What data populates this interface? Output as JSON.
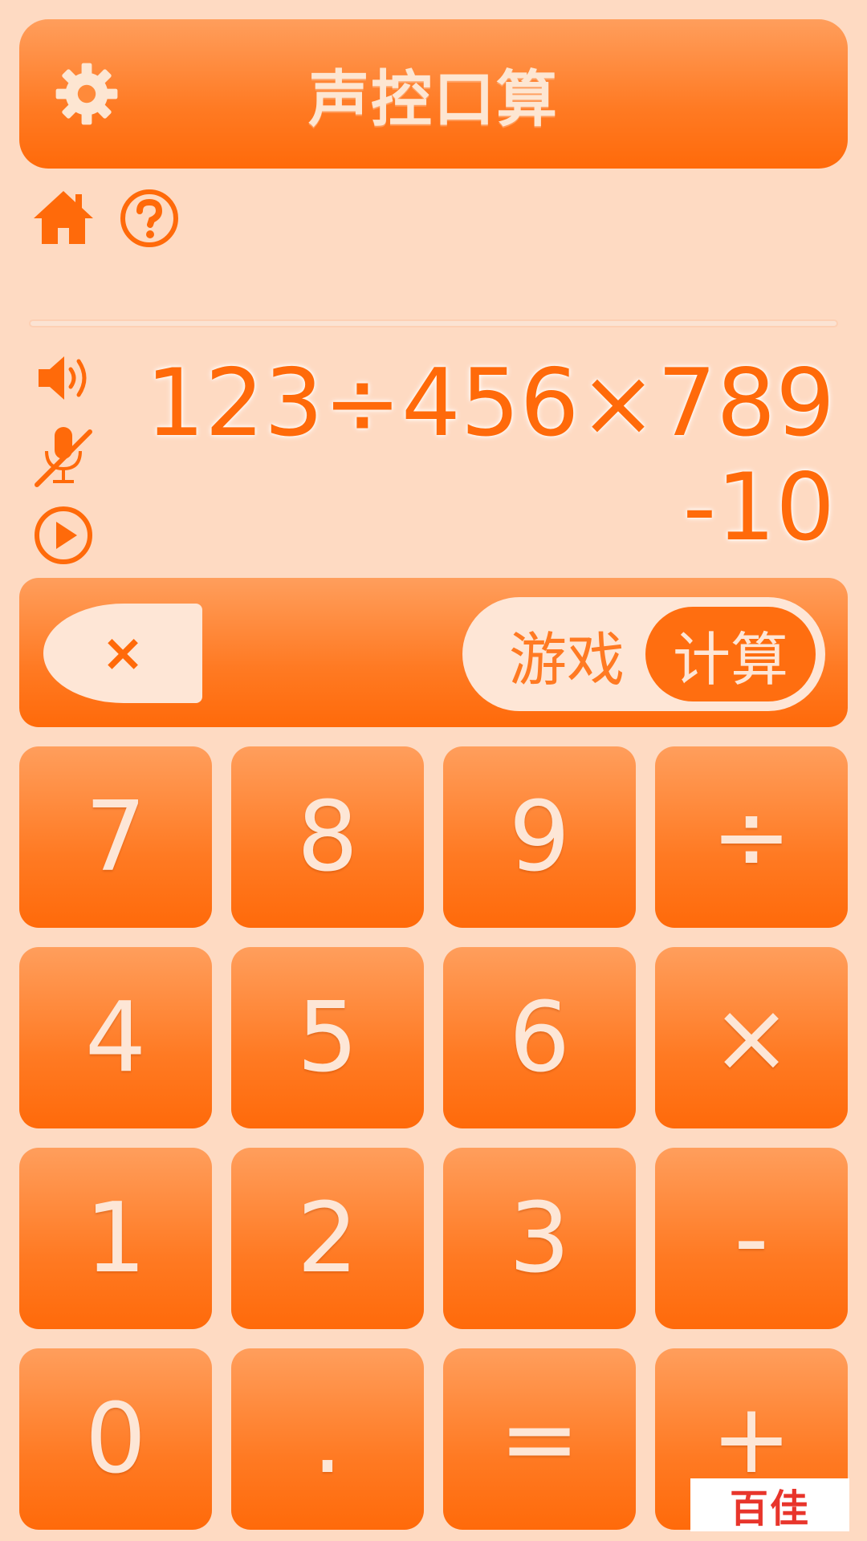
{
  "header": {
    "title": "声控口算",
    "settings_icon": "gear-icon"
  },
  "nav": {
    "home_icon": "home-icon",
    "help_icon": "help-icon"
  },
  "controls": {
    "speaker_icon": "speaker-icon",
    "mic_icon": "mic-off-icon",
    "play_icon": "play-icon"
  },
  "display": {
    "expression": "123÷456×789",
    "result": "-10"
  },
  "toolbar": {
    "clear_label": "×",
    "mode_game_label": "游戏",
    "mode_calc_label": "计算",
    "active_mode": "计算"
  },
  "keypad": {
    "k7": "7",
    "k8": "8",
    "k9": "9",
    "kdiv": "÷",
    "k4": "4",
    "k5": "5",
    "k6": "6",
    "kmul": "×",
    "k1": "1",
    "k2": "2",
    "k3": "3",
    "kminus": "-",
    "k0": "0",
    "kdot": ".",
    "keq": "=",
    "kplus": "+"
  },
  "watermark": {
    "text": "百佳"
  },
  "colors": {
    "background": "#fedac2",
    "accent": "#ff6a0a",
    "accent_light": "#ff9e5c",
    "key_text": "#fde6d6"
  }
}
